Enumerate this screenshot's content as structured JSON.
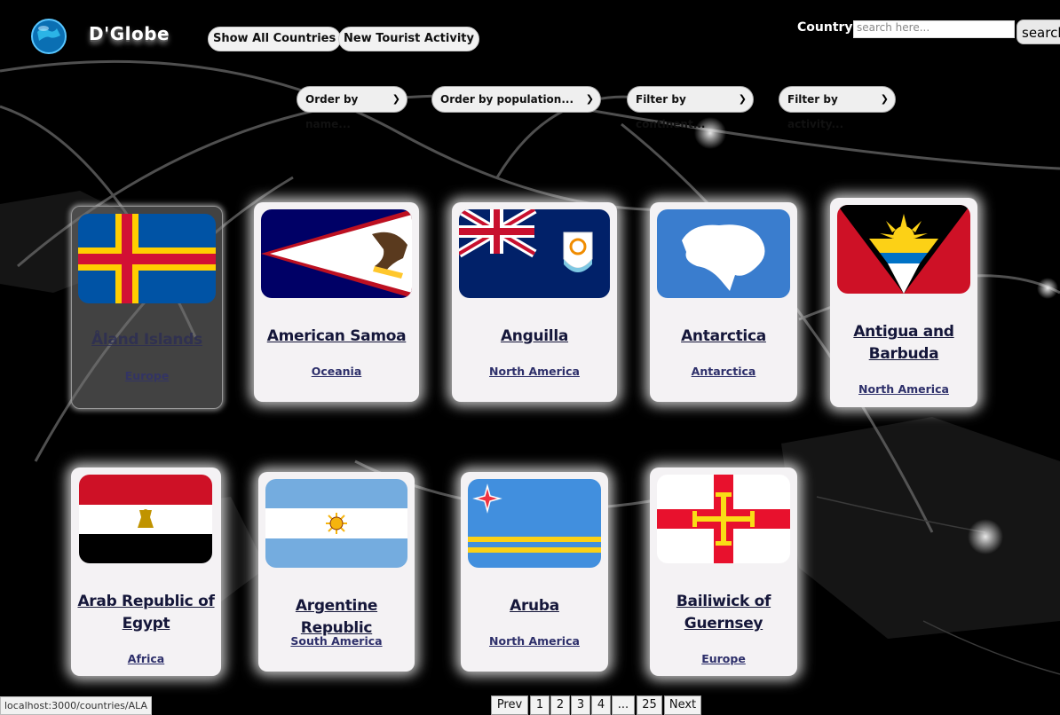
{
  "header": {
    "brand": "D'Globe",
    "nav": {
      "show_all": "Show All Countries",
      "new_activity": "New Tourist Activity"
    },
    "search": {
      "label": "Country:",
      "placeholder": "search here...",
      "button": "search"
    }
  },
  "filters": {
    "order_name": "Order by name...",
    "order_population": "Order by population...",
    "filter_continent": "Filter by continent...",
    "filter_activity": "Filter by activity..."
  },
  "cards": [
    {
      "name": "Åland Islands",
      "continent": "Europe"
    },
    {
      "name": "American Samoa",
      "continent": "Oceania"
    },
    {
      "name": "Anguilla",
      "continent": "North America"
    },
    {
      "name": "Antarctica",
      "continent": "Antarctica"
    },
    {
      "name": "Antigua and Barbuda",
      "continent": "North America"
    },
    {
      "name": "Arab Republic of Egypt",
      "continent": "Africa"
    },
    {
      "name": "Argentine Republic",
      "continent": "South America"
    },
    {
      "name": "Aruba",
      "continent": "North America"
    },
    {
      "name": "Bailiwick of Guernsey",
      "continent": "Europe"
    }
  ],
  "pagination": {
    "prev": "Prev",
    "pages": [
      "1",
      "2",
      "3",
      "4",
      "...",
      "25"
    ],
    "next": "Next"
  },
  "status_bar": "localhost:3000/countries/ALA"
}
